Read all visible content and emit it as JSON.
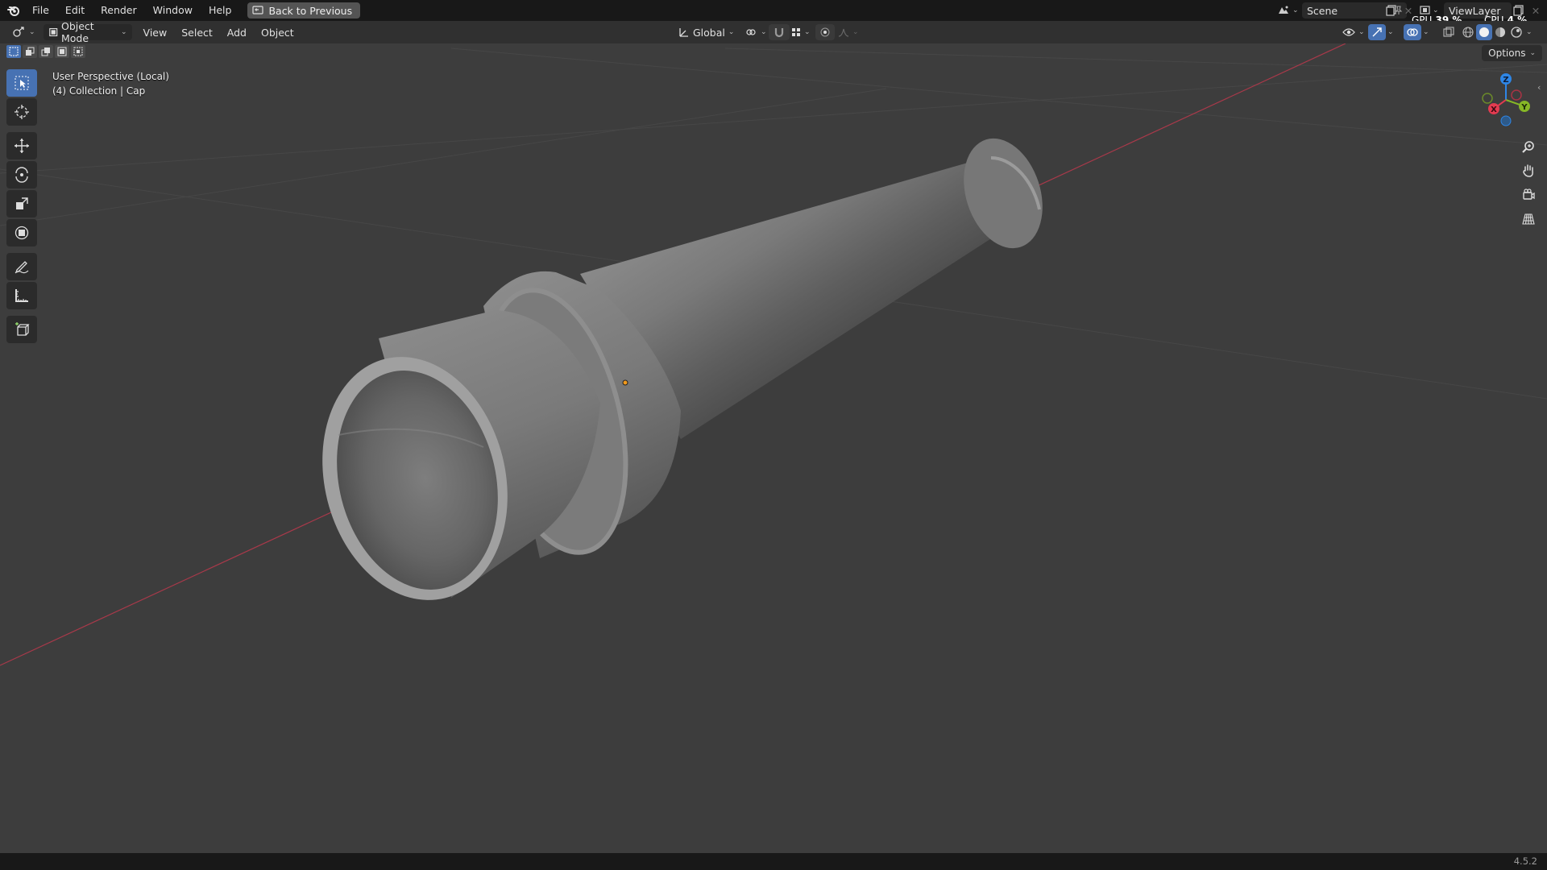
{
  "menubar": {
    "items": [
      "File",
      "Edit",
      "Render",
      "Window",
      "Help"
    ],
    "back_button": "Back to Previous",
    "scene": "Scene",
    "view_layer": "ViewLayer",
    "gpu_label": "GPU",
    "gpu_value": "39 %",
    "cpu_label": "CPU",
    "cpu_value": "4 %"
  },
  "header": {
    "mode": "Object Mode",
    "menus": [
      "View",
      "Select",
      "Add",
      "Object"
    ],
    "transform_orientation": "Global"
  },
  "viewport": {
    "view_name": "User Perspective (Local)",
    "collection_info": "(4) Collection | Cap",
    "options_label": "Options"
  },
  "gizmo": {
    "x": "X",
    "y": "Y",
    "z": "Z"
  },
  "colors": {
    "x_axis": "#e33b50",
    "y_axis": "#86b726",
    "z_axis": "#2e86e6",
    "active_blue": "#4772b3"
  },
  "status": {
    "version": "4.5.2"
  }
}
